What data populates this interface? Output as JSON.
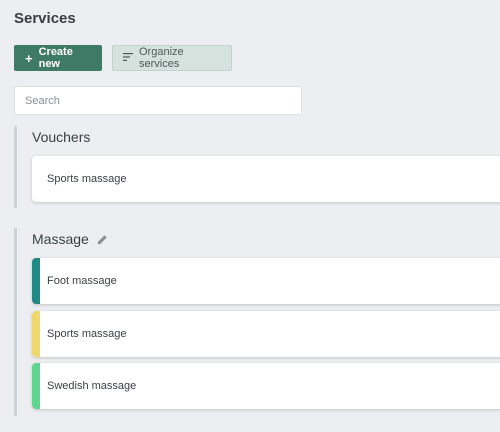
{
  "page": {
    "title": "Services"
  },
  "toolbar": {
    "create_label": "Create new",
    "organize_label": "Organize services"
  },
  "search": {
    "placeholder": "Search",
    "value": ""
  },
  "groups": [
    {
      "name": "Vouchers",
      "editable": false,
      "services": [
        {
          "name": "Sports massage",
          "color": ""
        }
      ]
    },
    {
      "name": "Massage",
      "editable": true,
      "services": [
        {
          "name": "Foot massage",
          "color": "#1e8a84"
        },
        {
          "name": "Sports massage",
          "color": "#f1d86c"
        },
        {
          "name": "Swedish massage",
          "color": "#5ed68f"
        }
      ]
    }
  ],
  "icons": {
    "create": "plus-icon",
    "organize": "sort-lines-icon",
    "edit": "pencil-icon"
  },
  "colors": {
    "primary": "#3f7a67",
    "secondary": "#d6e2de",
    "background": "#eceef1"
  }
}
